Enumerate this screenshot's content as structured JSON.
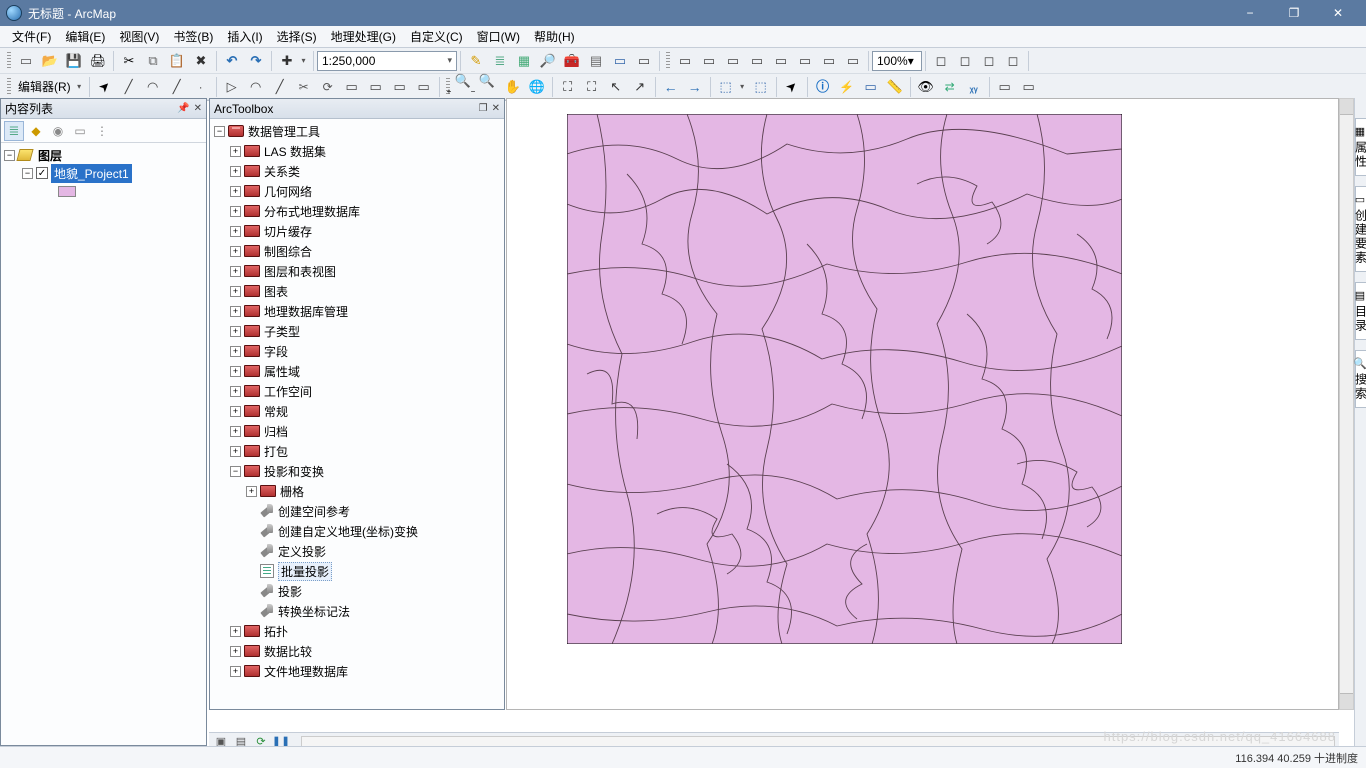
{
  "window": {
    "title": "无标题 - ArcMap"
  },
  "menu": [
    "文件(F)",
    "编辑(E)",
    "视图(V)",
    "书签(B)",
    "插入(I)",
    "选择(S)",
    "地理处理(G)",
    "自定义(C)",
    "窗口(W)",
    "帮助(H)"
  ],
  "toolbar": {
    "scale": "1:250,000",
    "zoom_pct": "100%",
    "editor_label": "编辑器(R)"
  },
  "toc": {
    "title": "内容列表",
    "root": "图层",
    "layer": "地貌_Project1"
  },
  "arctoolbox": {
    "title": "ArcToolbox",
    "root": "数据管理工具",
    "toolsets": [
      "LAS 数据集",
      "关系类",
      "几何网络",
      "分布式地理数据库",
      "切片缓存",
      "制图综合",
      "图层和表视图",
      "图表",
      "地理数据库管理",
      "子类型",
      "字段",
      "属性域",
      "工作空间",
      "常规",
      "归档",
      "打包"
    ],
    "proj_toolset": "投影和变换",
    "proj_sub": "栅格",
    "proj_tools": [
      "创建空间参考",
      "创建自定义地理(坐标)变换",
      "定义投影",
      "批量投影",
      "投影",
      "转换坐标记法"
    ],
    "proj_tool_highlight_index": 3,
    "toolsets_after": [
      "拓扑",
      "数据比较",
      "文件地理数据库"
    ]
  },
  "dock": {
    "tabs": [
      "属性",
      "创建要素",
      "目录",
      "搜索"
    ]
  },
  "status": {
    "coords": "116.394  40.259 十进制度"
  },
  "watermark": "https://blog.csdn.net/qq_41664688"
}
